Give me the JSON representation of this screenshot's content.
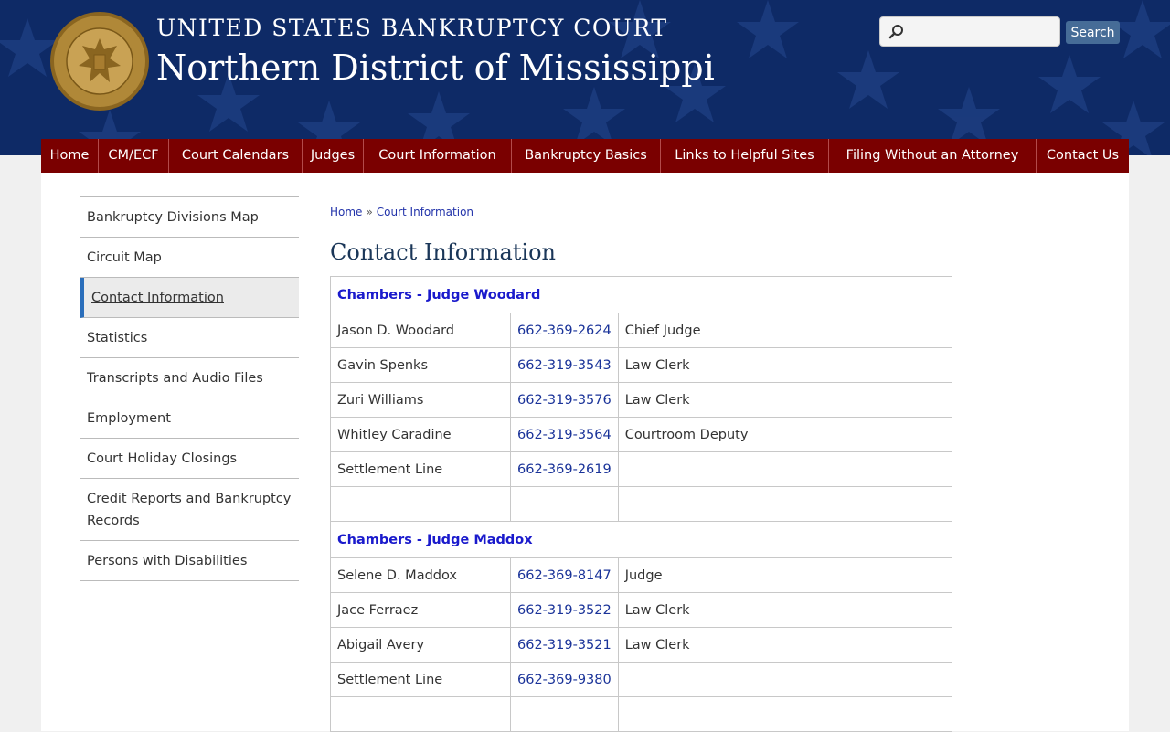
{
  "header": {
    "title_top": "UNITED STATES BANKRUPTCY COURT",
    "title_main": "Northern District of Mississippi",
    "seal_text": "UNITED STATES BANKRUPTCY COURT • NORTHERN DISTRICT OF MISSISSIPPI",
    "search_placeholder": "",
    "search_button": "Search"
  },
  "nav": [
    {
      "label": "Home"
    },
    {
      "label": "CM/ECF"
    },
    {
      "label": "Court Calendars"
    },
    {
      "label": "Judges"
    },
    {
      "label": "Court Information"
    },
    {
      "label": "Bankruptcy Basics"
    },
    {
      "label": "Links to Helpful Sites"
    },
    {
      "label": "Filing Without an Attorney"
    },
    {
      "label": "Contact Us"
    }
  ],
  "sidebar": [
    {
      "label": "Bankruptcy Divisions Map"
    },
    {
      "label": "Circuit Map"
    },
    {
      "label": "Contact Information"
    },
    {
      "label": "Statistics"
    },
    {
      "label": "Transcripts and Audio Files"
    },
    {
      "label": "Employment"
    },
    {
      "label": "Court Holiday Closings"
    },
    {
      "label": "Credit Reports and Bankruptcy Records"
    },
    {
      "label": "Persons with Disabilities"
    }
  ],
  "breadcrumb": {
    "home": "Home",
    "sep": "»",
    "current": "Court Information"
  },
  "page_title": "Contact Information",
  "chambers": [
    {
      "heading": "Chambers - Judge Woodard",
      "rows": [
        {
          "name": "Jason D. Woodard",
          "phone": "662-369-2624",
          "role": "Chief Judge"
        },
        {
          "name": "Gavin Spenks",
          "phone": "662-319-3543",
          "role": "Law Clerk"
        },
        {
          "name": "Zuri Williams",
          "phone": "662-319-3576",
          "role": "Law Clerk"
        },
        {
          "name": "Whitley Caradine",
          "phone": "662-319-3564",
          "role": "Courtroom Deputy"
        },
        {
          "name": "Settlement Line",
          "phone": "662-369-2619",
          "role": ""
        },
        {
          "name": "",
          "phone": "",
          "role": ""
        }
      ]
    },
    {
      "heading": "Chambers - Judge Maddox",
      "rows": [
        {
          "name": "Selene D. Maddox",
          "phone": "662-369-8147",
          "role": "Judge"
        },
        {
          "name": "Jace Ferraez",
          "phone": "662-319-3522",
          "role": "Law Clerk"
        },
        {
          "name": "Abigail Avery",
          "phone": "662-319-3521",
          "role": "Law Clerk"
        },
        {
          "name": "Settlement Line",
          "phone": "662-369-9380",
          "role": ""
        },
        {
          "name": "",
          "phone": "",
          "role": ""
        }
      ]
    }
  ],
  "colors": {
    "header_bg": "#0e2a66",
    "nav_bg": "#7a0000",
    "link": "#1a3399",
    "heading_link": "#1a1acc",
    "active_marker": "#2a6ebb"
  }
}
